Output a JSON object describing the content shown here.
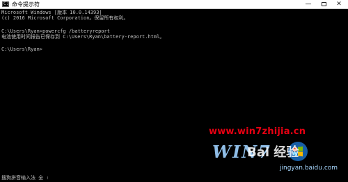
{
  "window": {
    "title": "命令提示符",
    "minimize_symbol": "—",
    "close_symbol": "✕"
  },
  "console": {
    "lines": [
      "Microsoft Windows [版本 10.0.14393]",
      "(c) 2016 Microsoft Corporation。保留所有权利。",
      "",
      "C:\\Users\\Ryan>powercfg /batteryreport",
      "电池使用时间报告已保存到 C:\\Users\\Ryan\\battery-report.html。",
      "",
      "C:\\Users\\Ryan>"
    ]
  },
  "ime_status": "搜狗拼音输入法 全 :",
  "watermark": {
    "site": "www.win7zhijia.cn",
    "logo_text": "WIN7",
    "baidu_logo": "Bai  经验",
    "baidu_url": "jingyan.baidu.com"
  }
}
